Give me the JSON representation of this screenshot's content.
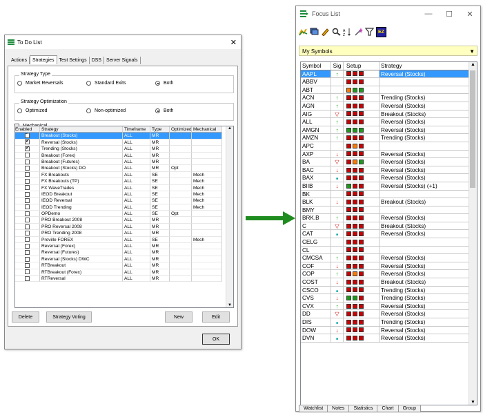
{
  "todo": {
    "title": "To Do List",
    "tabs": [
      "Actions",
      "Strategies",
      "Test Settings",
      "DSS",
      "Server Signals"
    ],
    "active_tab": "Strategies",
    "strategy_type": {
      "label": "Strategy Type",
      "options": [
        "Market Reversals",
        "Standard Exits",
        "Both"
      ],
      "selected": "Both"
    },
    "strategy_optimization": {
      "label": "Strategy Optimization",
      "options": [
        "Optimized",
        "Non-optimized",
        "Both"
      ],
      "selected": "Both"
    },
    "mechanical_label": "Mechanical",
    "columns": [
      "Enabled",
      "Strategy",
      "Timeframe",
      "Type",
      "Optimized",
      "Mechanical"
    ],
    "rows": [
      {
        "en": true,
        "s": "Breakout (Stocks)",
        "tf": "ALL",
        "t": "MR",
        "o": "",
        "m": "",
        "sel": true
      },
      {
        "en": true,
        "s": "Reversal (Stocks)",
        "tf": "ALL",
        "t": "MR",
        "o": "",
        "m": ""
      },
      {
        "en": true,
        "s": "Trending (Stocks)",
        "tf": "ALL",
        "t": "MR",
        "o": "",
        "m": ""
      },
      {
        "en": false,
        "s": "Breakout (Forex)",
        "tf": "ALL",
        "t": "MR",
        "o": "",
        "m": ""
      },
      {
        "en": false,
        "s": "Breakout (Futures)",
        "tf": "ALL",
        "t": "MR",
        "o": "",
        "m": ""
      },
      {
        "en": false,
        "s": "Breakout (Stocks) DO",
        "tf": "ALL",
        "t": "MR",
        "o": "Opt",
        "m": ""
      },
      {
        "en": false,
        "s": "FX Breakouts",
        "tf": "ALL",
        "t": "SE",
        "o": "",
        "m": "Mech"
      },
      {
        "en": false,
        "s": "FX Breakouts (TP)",
        "tf": "ALL",
        "t": "SE",
        "o": "",
        "m": "Mech"
      },
      {
        "en": false,
        "s": "FX WaveTrades",
        "tf": "ALL",
        "t": "SE",
        "o": "",
        "m": "Mech"
      },
      {
        "en": false,
        "s": "IEOD Breakout",
        "tf": "ALL",
        "t": "SE",
        "o": "",
        "m": "Mech"
      },
      {
        "en": false,
        "s": "IEOD Reversal",
        "tf": "ALL",
        "t": "SE",
        "o": "",
        "m": "Mech"
      },
      {
        "en": false,
        "s": "IEOD Trending",
        "tf": "ALL",
        "t": "SE",
        "o": "",
        "m": "Mech"
      },
      {
        "en": false,
        "s": "OPDemo",
        "tf": "ALL",
        "t": "SE",
        "o": "Opt",
        "m": ""
      },
      {
        "en": false,
        "s": "PRO Breakout 2008",
        "tf": "ALL",
        "t": "MR",
        "o": "",
        "m": ""
      },
      {
        "en": false,
        "s": "PRO Reversal 2008",
        "tf": "ALL",
        "t": "MR",
        "o": "",
        "m": ""
      },
      {
        "en": false,
        "s": "PRO Trending 2008",
        "tf": "ALL",
        "t": "MR",
        "o": "",
        "m": ""
      },
      {
        "en": false,
        "s": "Proville FOREX",
        "tf": "ALL",
        "t": "SE",
        "o": "",
        "m": "Mech"
      },
      {
        "en": false,
        "s": "Reversal (Forex)",
        "tf": "ALL",
        "t": "MR",
        "o": "",
        "m": ""
      },
      {
        "en": false,
        "s": "Reversal (Futures)",
        "tf": "ALL",
        "t": "MR",
        "o": "",
        "m": ""
      },
      {
        "en": false,
        "s": "Reversal (Stocks) DWC",
        "tf": "ALL",
        "t": "MR",
        "o": "",
        "m": ""
      },
      {
        "en": false,
        "s": "RTBreakout",
        "tf": "ALL",
        "t": "MR",
        "o": "",
        "m": ""
      },
      {
        "en": false,
        "s": "RTBreakout (Forex)",
        "tf": "ALL",
        "t": "MR",
        "o": "",
        "m": ""
      },
      {
        "en": false,
        "s": "RTReversal",
        "tf": "ALL",
        "t": "MR",
        "o": "",
        "m": ""
      }
    ],
    "buttons": {
      "delete": "Delete",
      "voting": "Strategy Voting",
      "new": "New",
      "edit": "Edit",
      "ok": "OK"
    }
  },
  "focus": {
    "title": "Focus List",
    "list_name": "My Symbols",
    "columns": [
      "Symbol",
      "Sig",
      "Setup",
      "Strategy"
    ],
    "colors": {
      "red": "#cc0000",
      "green": "#1a9a1a",
      "orange": "#ff7a00",
      "teal": "#00a0a0",
      "lime": "#33cc33"
    },
    "rows": [
      {
        "sym": "AAPL",
        "sig": "up",
        "setup": [
          "red",
          "red",
          "red"
        ],
        "str": "Reversal (Stocks)",
        "sel": true
      },
      {
        "sym": "ABBV",
        "sig": "",
        "setup": [
          "red",
          "red",
          "red"
        ],
        "str": ""
      },
      {
        "sym": "ABT",
        "sig": "",
        "setup": [
          "orange",
          "green",
          "green"
        ],
        "str": ""
      },
      {
        "sym": "ACN",
        "sig": "up",
        "setup": [
          "red",
          "red",
          "red"
        ],
        "str": "Trending (Stocks)"
      },
      {
        "sym": "AGN",
        "sig": "up",
        "setup": [
          "red",
          "red",
          "red"
        ],
        "str": "Reversal (Stocks)"
      },
      {
        "sym": "AIG",
        "sig": "hollow",
        "setup": [
          "red",
          "red",
          "red"
        ],
        "str": "Breakout (Stocks)"
      },
      {
        "sym": "ALL",
        "sig": "up",
        "setup": [
          "red",
          "red",
          "red"
        ],
        "str": "Reversal (Stocks)"
      },
      {
        "sym": "AMGN",
        "sig": "up",
        "setup": [
          "green",
          "green",
          "green"
        ],
        "str": "Reversal (Stocks)"
      },
      {
        "sym": "AMZN",
        "sig": "up",
        "setup": [
          "red",
          "red",
          "red"
        ],
        "str": "Trending (Stocks)"
      },
      {
        "sym": "APC",
        "sig": "",
        "setup": [
          "red",
          "orange",
          "red"
        ],
        "str": ""
      },
      {
        "sym": "AXP",
        "sig": "down",
        "setup": [
          "red",
          "red",
          "red"
        ],
        "str": "Reversal (Stocks)"
      },
      {
        "sym": "BA",
        "sig": "hollow",
        "setup": [
          "red",
          "orange",
          "green"
        ],
        "str": "Reversal (Stocks)"
      },
      {
        "sym": "BAC",
        "sig": "down",
        "setup": [
          "red",
          "red",
          "red"
        ],
        "str": "Reversal (Stocks)"
      },
      {
        "sym": "BAX",
        "sig": "dash",
        "setup": [
          "red",
          "red",
          "red"
        ],
        "str": "Reversal (Stocks)"
      },
      {
        "sym": "BIIB",
        "sig": "down",
        "setup": [
          "green",
          "red",
          "red"
        ],
        "str": "Reversal (Stocks) (+1)"
      },
      {
        "sym": "BK",
        "sig": "",
        "setup": [
          "red",
          "red",
          "red"
        ],
        "str": ""
      },
      {
        "sym": "BLK",
        "sig": "down",
        "setup": [
          "red",
          "red",
          "red"
        ],
        "str": "Breakout (Stocks)"
      },
      {
        "sym": "BMY",
        "sig": "",
        "setup": [
          "red",
          "red",
          "red"
        ],
        "str": ""
      },
      {
        "sym": "BRK.B",
        "sig": "up",
        "setup": [
          "red",
          "red",
          "red"
        ],
        "str": "Reversal (Stocks)"
      },
      {
        "sym": "C",
        "sig": "hollow",
        "setup": [
          "red",
          "red",
          "red"
        ],
        "str": "Breakout (Stocks)"
      },
      {
        "sym": "CAT",
        "sig": "dash",
        "setup": [
          "red",
          "red",
          "red"
        ],
        "str": "Reversal (Stocks)"
      },
      {
        "sym": "CELG",
        "sig": "",
        "setup": [
          "red",
          "red",
          "red"
        ],
        "str": ""
      },
      {
        "sym": "CL",
        "sig": "",
        "setup": [
          "red",
          "red",
          "red"
        ],
        "str": ""
      },
      {
        "sym": "CMCSA",
        "sig": "up",
        "setup": [
          "red",
          "red",
          "red"
        ],
        "str": "Reversal (Stocks)"
      },
      {
        "sym": "COF",
        "sig": "down",
        "setup": [
          "red",
          "red",
          "red"
        ],
        "str": "Reversal (Stocks)"
      },
      {
        "sym": "COP",
        "sig": "up",
        "setup": [
          "red",
          "orange",
          "red"
        ],
        "str": "Reversal (Stocks)"
      },
      {
        "sym": "COST",
        "sig": "down",
        "setup": [
          "red",
          "red",
          "red"
        ],
        "str": "Breakout (Stocks)"
      },
      {
        "sym": "CSCO",
        "sig": "dash",
        "setup": [
          "red",
          "red",
          "red"
        ],
        "str": "Trending (Stocks)"
      },
      {
        "sym": "CVS",
        "sig": "down",
        "setup": [
          "green",
          "green",
          "red"
        ],
        "str": "Trending (Stocks)"
      },
      {
        "sym": "CVX",
        "sig": "up",
        "setup": [
          "red",
          "red",
          "red"
        ],
        "str": "Reversal (Stocks)"
      },
      {
        "sym": "DD",
        "sig": "hollow",
        "setup": [
          "red",
          "red",
          "red"
        ],
        "str": "Reversal (Stocks)"
      },
      {
        "sym": "DIS",
        "sig": "dash",
        "setup": [
          "red",
          "red",
          "red"
        ],
        "str": "Trending (Stocks)"
      },
      {
        "sym": "DOW",
        "sig": "down",
        "setup": [
          "red",
          "red",
          "red"
        ],
        "str": "Reversal (Stocks)"
      },
      {
        "sym": "DVN",
        "sig": "dash",
        "setup": [
          "red",
          "red",
          "red"
        ],
        "str": "Reversal (Stocks)"
      }
    ],
    "bottom_tabs": [
      "Watchlist",
      "Notes",
      "Statistics",
      "Chart",
      "Group"
    ]
  }
}
